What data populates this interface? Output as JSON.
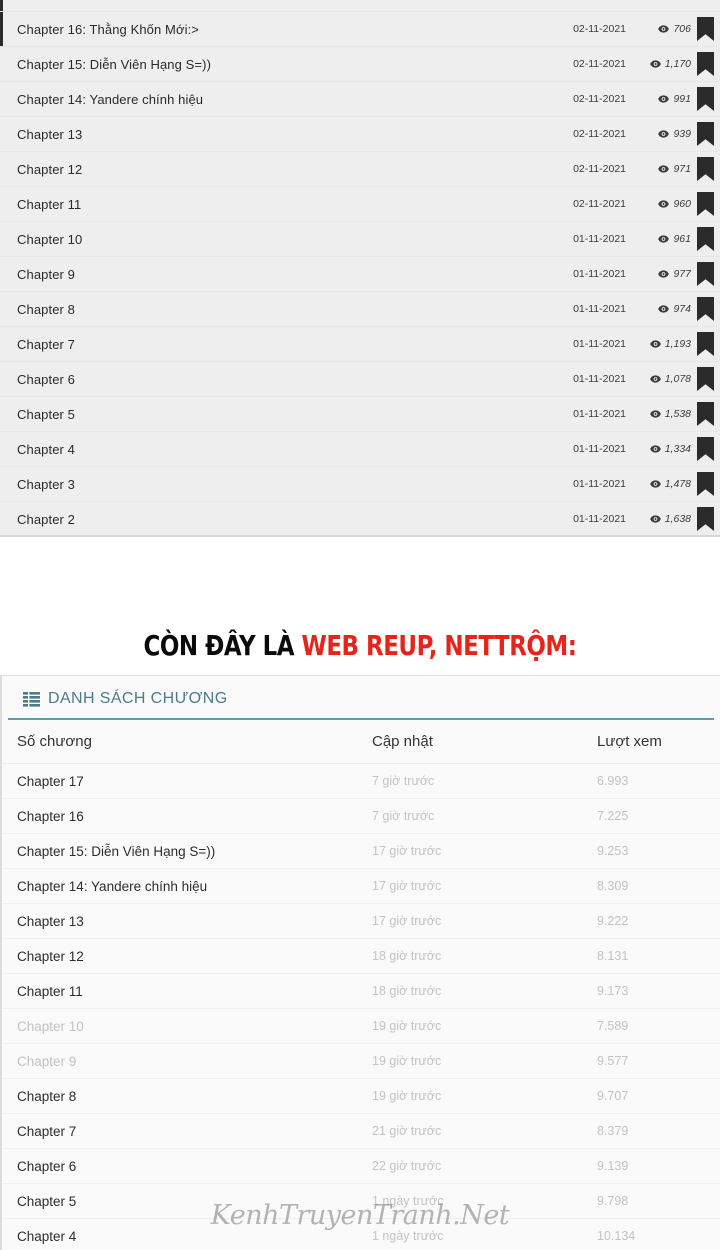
{
  "section_one": {
    "name": "dark-chapter-list",
    "clipped_top_row": true,
    "rows": [
      {
        "title": "Chapter 16: Thằng Khốn Mới:>",
        "date": "02-11-2021",
        "views": "706",
        "bookmark_icon": "bookmark-icon",
        "eye_icon": "eye-icon"
      },
      {
        "title": "Chapter 15: Diễn Viên Hạng S=))",
        "date": "02-11-2021",
        "views": "1,170",
        "bookmark_icon": "bookmark-icon",
        "eye_icon": "eye-icon"
      },
      {
        "title": "Chapter 14: Yandere chính hiệu",
        "date": "02-11-2021",
        "views": "991",
        "bookmark_icon": "bookmark-icon",
        "eye_icon": "eye-icon"
      },
      {
        "title": "Chapter 13",
        "date": "02-11-2021",
        "views": "939",
        "bookmark_icon": "bookmark-icon",
        "eye_icon": "eye-icon"
      },
      {
        "title": "Chapter 12",
        "date": "02-11-2021",
        "views": "971",
        "bookmark_icon": "bookmark-icon",
        "eye_icon": "eye-icon"
      },
      {
        "title": "Chapter 11",
        "date": "02-11-2021",
        "views": "960",
        "bookmark_icon": "bookmark-icon",
        "eye_icon": "eye-icon"
      },
      {
        "title": "Chapter 10",
        "date": "01-11-2021",
        "views": "961",
        "bookmark_icon": "bookmark-icon",
        "eye_icon": "eye-icon"
      },
      {
        "title": "Chapter 9",
        "date": "01-11-2021",
        "views": "977",
        "bookmark_icon": "bookmark-icon",
        "eye_icon": "eye-icon"
      },
      {
        "title": "Chapter 8",
        "date": "01-11-2021",
        "views": "974",
        "bookmark_icon": "bookmark-icon",
        "eye_icon": "eye-icon"
      },
      {
        "title": "Chapter 7",
        "date": "01-11-2021",
        "views": "1,193",
        "bookmark_icon": "bookmark-icon",
        "eye_icon": "eye-icon"
      },
      {
        "title": "Chapter 6",
        "date": "01-11-2021",
        "views": "1,078",
        "bookmark_icon": "bookmark-icon",
        "eye_icon": "eye-icon"
      },
      {
        "title": "Chapter 5",
        "date": "01-11-2021",
        "views": "1,538",
        "bookmark_icon": "bookmark-icon",
        "eye_icon": "eye-icon"
      },
      {
        "title": "Chapter 4",
        "date": "01-11-2021",
        "views": "1,334",
        "bookmark_icon": "bookmark-icon",
        "eye_icon": "eye-icon"
      },
      {
        "title": "Chapter 3",
        "date": "01-11-2021",
        "views": "1,478",
        "bookmark_icon": "bookmark-icon",
        "eye_icon": "eye-icon"
      },
      {
        "title": "Chapter 2",
        "date": "01-11-2021",
        "views": "1,638",
        "bookmark_icon": "bookmark-icon",
        "eye_icon": "eye-icon"
      }
    ]
  },
  "banner": {
    "black_text": "CÒN ĐÂY LÀ ",
    "red_text": "WEB REUP, NETTRỘM:",
    "red_color": "#e8231b",
    "black_color": "#0a0a0a"
  },
  "section_two": {
    "name": "light-chapter-list",
    "header": {
      "icon": "list-icon",
      "label": "DANH SÁCH CHƯƠNG",
      "accent_color": "#5f9ea8",
      "label_color": "#4d7c86"
    },
    "columns": {
      "chapter": "Số chương",
      "updated": "Cập nhật",
      "views": "Lượt xem"
    },
    "rows": [
      {
        "title": "Chapter 17",
        "updated": "7 giờ trước",
        "views": "6.993",
        "visited": false
      },
      {
        "title": "Chapter 16",
        "updated": "7 giờ trước",
        "views": "7.225",
        "visited": false
      },
      {
        "title": "Chapter 15: Diễn Viên Hạng S=))",
        "updated": "17 giờ trước",
        "views": "9.253",
        "visited": false
      },
      {
        "title": "Chapter 14: Yandere chính hiệu",
        "updated": "17 giờ trước",
        "views": "8.309",
        "visited": false
      },
      {
        "title": "Chapter 13",
        "updated": "17 giờ trước",
        "views": "9.222",
        "visited": false
      },
      {
        "title": "Chapter 12",
        "updated": "18 giờ trước",
        "views": "8.131",
        "visited": false
      },
      {
        "title": "Chapter 11",
        "updated": "18 giờ trước",
        "views": "9.173",
        "visited": false
      },
      {
        "title": "Chapter 10",
        "updated": "19 giờ trước",
        "views": "7.589",
        "visited": true
      },
      {
        "title": "Chapter 9",
        "updated": "19 giờ trước",
        "views": "9.577",
        "visited": true
      },
      {
        "title": "Chapter 8",
        "updated": "19 giờ trước",
        "views": "9.707",
        "visited": false
      },
      {
        "title": "Chapter 7",
        "updated": "21 giờ trước",
        "views": "8.379",
        "visited": false
      },
      {
        "title": "Chapter 6",
        "updated": "22 giờ trước",
        "views": "9.139",
        "visited": false
      },
      {
        "title": "Chapter 5",
        "updated": "1 ngày trước",
        "views": "9.798",
        "visited": false
      },
      {
        "title": "Chapter 4",
        "updated": "1 ngày trước",
        "views": "10.134",
        "visited": false
      }
    ]
  },
  "watermark": {
    "text": "KenhTruyenTranh.Net"
  }
}
